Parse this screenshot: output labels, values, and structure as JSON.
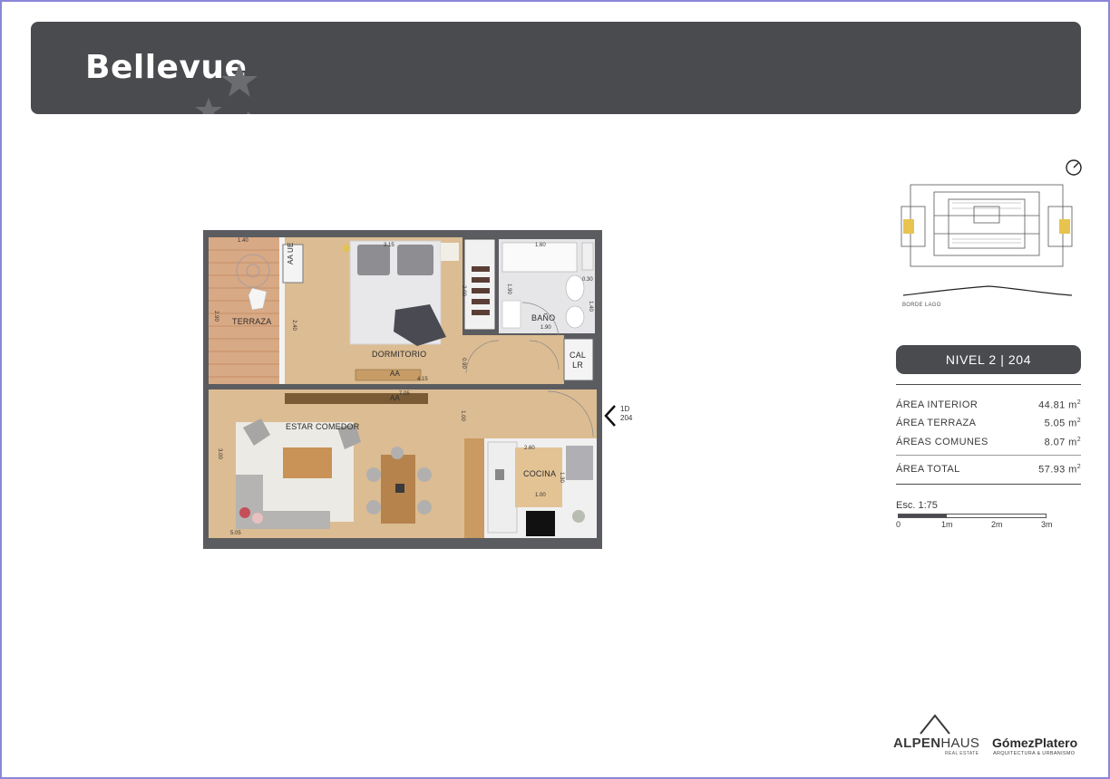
{
  "header": {
    "logo": "Bellevue"
  },
  "plan": {
    "rooms": {
      "terraza": "TERRAZA",
      "dormitorio": "DORMITORIO",
      "bano": "BAÑO",
      "estar_comedor": "ESTAR COMEDOR",
      "cocina": "COCINA",
      "aa_ue": "AA UE",
      "cal_lr": "CAL\nLR",
      "aa_1": "AA",
      "aa_2": "AA"
    },
    "dimensions": {
      "d_1_40": "1.40",
      "d_2_90": "2.90",
      "d_2_40": "2.40",
      "d_3_15": "3.15",
      "d_2_00": "2.00",
      "d_4_15": "4.15",
      "d_1_60": "1.60",
      "d_0_30": "0.30",
      "d_1_90a": "1.90",
      "d_1_90b": "1.90",
      "d_1_40b": "1.40",
      "d_0_90": "0.90",
      "d_1_00a": "1.00",
      "d_7_05": "7.05",
      "d_3_00": "3.00",
      "d_5_05": "5.05",
      "d_2_60": "2.60",
      "d_1_30": "1.30",
      "d_1_00b": "1.00"
    },
    "door_tag": {
      "line1": "1D",
      "line2": "204"
    }
  },
  "keyplan": {
    "lake_label": "BORDE LAGO"
  },
  "level": {
    "label": "NIVEL 2 | 204"
  },
  "areas": [
    {
      "label": "ÁREA INTERIOR",
      "value": "44.81 m",
      "unit_sup": "2"
    },
    {
      "label": "ÁREA TERRAZA",
      "value": "5.05 m",
      "unit_sup": "2"
    },
    {
      "label": "ÁREAS COMUNES",
      "value": "8.07 m",
      "unit_sup": "2"
    }
  ],
  "total": {
    "label": "ÁREA TOTAL",
    "value": "57.93 m",
    "unit_sup": "2"
  },
  "scale": {
    "label": "Esc. 1:75",
    "ticks": [
      "0",
      "1m",
      "2m",
      "3m"
    ]
  },
  "footer": {
    "alpen_name_bold": "ALPEN",
    "alpen_name_rest": "HAUS",
    "alpen_sub": "REAL ESTATE",
    "gp_name": "GómezPlatero",
    "gp_sub": "ARQUITECTURA & URBANISMO"
  },
  "colors": {
    "header_bg": "#4a4b4f",
    "wall": "#5b5c60",
    "wood_floor": "#d9b98f",
    "tile_floor": "#e6e6e6",
    "frame_border": "#8a86d8"
  }
}
